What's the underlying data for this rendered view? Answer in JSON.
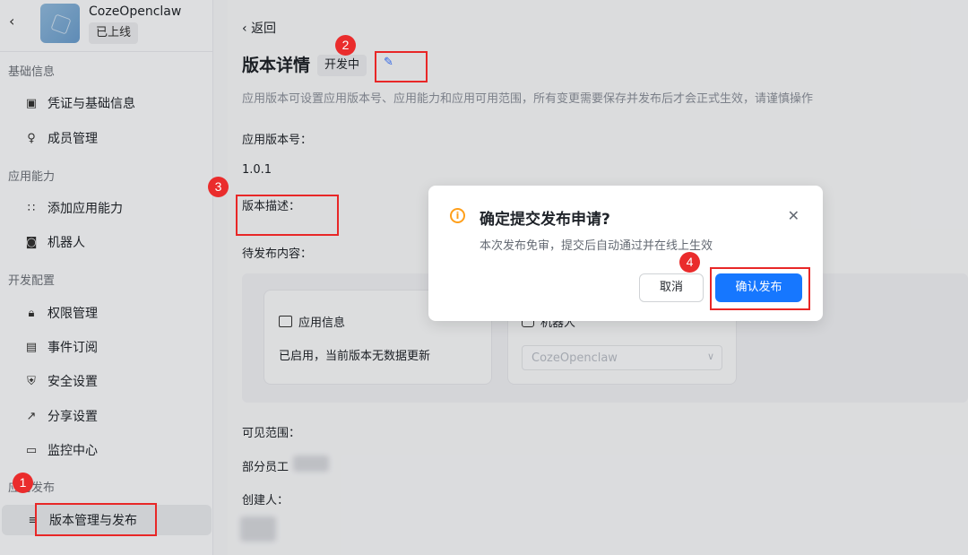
{
  "app": {
    "name": "CozeOpenclaw",
    "status": "已上线"
  },
  "sidebar": {
    "groups": [
      {
        "title": "基础信息",
        "items": [
          {
            "label": "凭证与基础信息",
            "icon": "credential-icon"
          },
          {
            "label": "成员管理",
            "icon": "member-icon"
          }
        ]
      },
      {
        "title": "应用能力",
        "items": [
          {
            "label": "添加应用能力",
            "icon": "add-capability-icon"
          },
          {
            "label": "机器人",
            "icon": "robot-icon"
          }
        ]
      },
      {
        "title": "开发配置",
        "items": [
          {
            "label": "权限管理",
            "icon": "lock-icon"
          },
          {
            "label": "事件订阅",
            "icon": "event-icon"
          },
          {
            "label": "安全设置",
            "icon": "shield-icon"
          },
          {
            "label": "分享设置",
            "icon": "share-icon"
          },
          {
            "label": "监控中心",
            "icon": "monitor-icon"
          }
        ]
      },
      {
        "title": "应用发布",
        "items": [
          {
            "label": "版本管理与发布",
            "icon": "layers-icon",
            "active": true
          }
        ]
      }
    ]
  },
  "main": {
    "back_label": "返回",
    "title": "版本详情",
    "badge": "开发中",
    "description": "应用版本可设置应用版本号、应用能力和应用可用范围，所有变更需要保存并发布后才会正式生效，请谨慎操作",
    "version_label": "应用版本号：",
    "version_value": "1.0.1",
    "version_desc_label": "版本描述：",
    "pending_label": "待发布内容：",
    "card_app_info": {
      "title": "应用信息",
      "text": "已启用，当前版本无数据更新"
    },
    "card_robot": {
      "title": "机器人",
      "select_value": "CozeOpenclaw"
    },
    "visibility_label": "可见范围：",
    "visibility_value": "部分员工",
    "creator_label": "创建人："
  },
  "modal": {
    "title": "确定提交发布申请?",
    "description": "本次发布免审，提交后自动通过并在线上生效",
    "cancel_label": "取消",
    "confirm_label": "确认发布"
  },
  "annotations": {
    "steps": [
      "1",
      "2",
      "3",
      "4"
    ],
    "color": "#e82727"
  },
  "colors": {
    "primary": "#1677ff",
    "warning": "#ff9f1a"
  }
}
